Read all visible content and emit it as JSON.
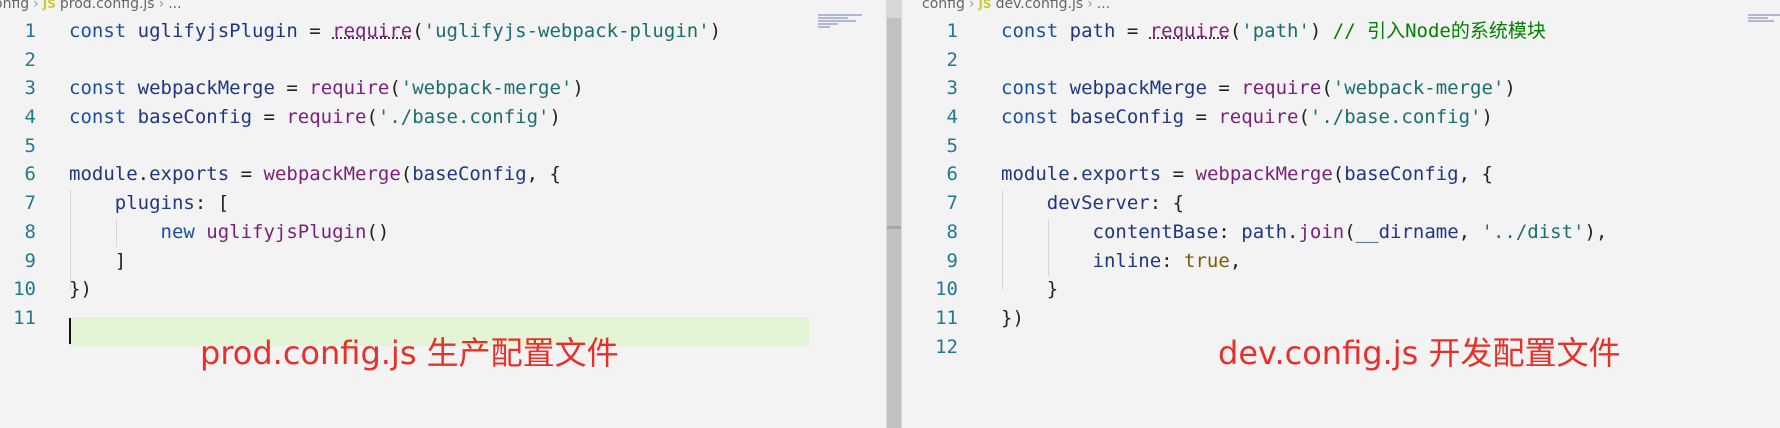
{
  "left_pane": {
    "breadcrumb": {
      "folder": "onfig",
      "file_icon": "JS",
      "file": "prod.config.js",
      "tail": "..."
    },
    "lines": [
      {
        "n": "1",
        "tokens": [
          [
            "kw",
            "const "
          ],
          [
            "var",
            "uglifyjsPlugin"
          ],
          [
            "op",
            " = "
          ],
          [
            "fn",
            "require"
          ],
          [
            "op",
            "("
          ],
          [
            "str",
            "'uglifyjs-webpack-plugin'"
          ],
          [
            "op",
            ")"
          ]
        ]
      },
      {
        "n": "2",
        "tokens": []
      },
      {
        "n": "3",
        "tokens": [
          [
            "kw",
            "const "
          ],
          [
            "var",
            "webpackMerge"
          ],
          [
            "op",
            " = "
          ],
          [
            "fn",
            "require"
          ],
          [
            "op",
            "("
          ],
          [
            "str",
            "'webpack-merge'"
          ],
          [
            "op",
            ")"
          ]
        ]
      },
      {
        "n": "4",
        "tokens": [
          [
            "kw",
            "const "
          ],
          [
            "var",
            "baseConfig"
          ],
          [
            "op",
            " = "
          ],
          [
            "fn",
            "require"
          ],
          [
            "op",
            "("
          ],
          [
            "str",
            "'./base.config'"
          ],
          [
            "op",
            ")"
          ]
        ]
      },
      {
        "n": "5",
        "tokens": []
      },
      {
        "n": "6",
        "tokens": [
          [
            "var",
            "module"
          ],
          [
            "op",
            "."
          ],
          [
            "var",
            "exports"
          ],
          [
            "op",
            " = "
          ],
          [
            "fn",
            "webpackMerge"
          ],
          [
            "op",
            "("
          ],
          [
            "var",
            "baseConfig"
          ],
          [
            "op",
            ", {"
          ]
        ]
      },
      {
        "n": "7",
        "tokens": [
          [
            "op",
            "    "
          ],
          [
            "var",
            "plugins"
          ],
          [
            "op",
            ": ["
          ]
        ]
      },
      {
        "n": "8",
        "tokens": [
          [
            "op",
            "        "
          ],
          [
            "kw",
            "new "
          ],
          [
            "fn",
            "uglifyjsPlugin"
          ],
          [
            "op",
            "()"
          ]
        ]
      },
      {
        "n": "9",
        "tokens": [
          [
            "op",
            "    ]"
          ]
        ]
      },
      {
        "n": "10",
        "tokens": [
          [
            "op",
            "})"
          ]
        ]
      },
      {
        "n": "11",
        "tokens": []
      }
    ],
    "caption": "prod.config.js  生产配置文件"
  },
  "right_pane": {
    "breadcrumb": {
      "folder": "config",
      "file_icon": "JS",
      "file": "dev.config.js",
      "tail": "..."
    },
    "lines": [
      {
        "n": "1",
        "tokens": [
          [
            "kw",
            "const "
          ],
          [
            "var",
            "path"
          ],
          [
            "op",
            " = "
          ],
          [
            "fn",
            "require"
          ],
          [
            "op",
            "("
          ],
          [
            "str",
            "'path'"
          ],
          [
            "op",
            ") "
          ],
          [
            "cmt",
            "// 引入Node的系统模块"
          ]
        ]
      },
      {
        "n": "2",
        "tokens": []
      },
      {
        "n": "3",
        "tokens": [
          [
            "kw",
            "const "
          ],
          [
            "var",
            "webpackMerge"
          ],
          [
            "op",
            " = "
          ],
          [
            "fn",
            "require"
          ],
          [
            "op",
            "("
          ],
          [
            "str",
            "'webpack-merge'"
          ],
          [
            "op",
            ")"
          ]
        ]
      },
      {
        "n": "4",
        "tokens": [
          [
            "kw",
            "const "
          ],
          [
            "var",
            "baseConfig"
          ],
          [
            "op",
            " = "
          ],
          [
            "fn",
            "require"
          ],
          [
            "op",
            "("
          ],
          [
            "str",
            "'./base.config'"
          ],
          [
            "op",
            ")"
          ]
        ]
      },
      {
        "n": "5",
        "tokens": []
      },
      {
        "n": "6",
        "tokens": [
          [
            "var",
            "module"
          ],
          [
            "op",
            "."
          ],
          [
            "var",
            "exports"
          ],
          [
            "op",
            " = "
          ],
          [
            "fn",
            "webpackMerge"
          ],
          [
            "op",
            "("
          ],
          [
            "var",
            "baseConfig"
          ],
          [
            "op",
            ", {"
          ]
        ]
      },
      {
        "n": "7",
        "tokens": [
          [
            "op",
            "    "
          ],
          [
            "var",
            "devServer"
          ],
          [
            "op",
            ": {"
          ]
        ]
      },
      {
        "n": "8",
        "tokens": [
          [
            "op",
            "        "
          ],
          [
            "var",
            "contentBase"
          ],
          [
            "op",
            ": "
          ],
          [
            "var",
            "path"
          ],
          [
            "op",
            "."
          ],
          [
            "fn",
            "join"
          ],
          [
            "op",
            "("
          ],
          [
            "var",
            "__dirname"
          ],
          [
            "op",
            ", "
          ],
          [
            "str",
            "'../dist'"
          ],
          [
            "op",
            "),"
          ]
        ]
      },
      {
        "n": "9",
        "tokens": [
          [
            "op",
            "        "
          ],
          [
            "var",
            "inline"
          ],
          [
            "op",
            ": "
          ],
          [
            "bool",
            "true"
          ],
          [
            "op",
            ","
          ]
        ]
      },
      {
        "n": "10",
        "tokens": [
          [
            "op",
            "    }"
          ]
        ]
      },
      {
        "n": "11",
        "tokens": [
          [
            "op",
            "})"
          ]
        ]
      },
      {
        "n": "12",
        "tokens": []
      }
    ],
    "caption": "dev.config.js  开发配置文件"
  },
  "colors": {
    "caption": "#e8302b",
    "line_number": "#237893",
    "current_line_highlight": "#e4f5d6"
  }
}
